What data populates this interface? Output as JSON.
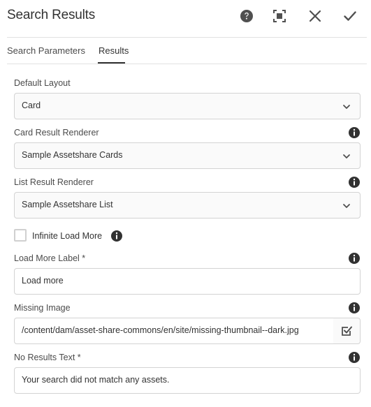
{
  "dialog": {
    "title": "Search Results"
  },
  "header_actions": {
    "help_icon": "question-circle-icon",
    "fullscreen_icon": "fullscreen-icon",
    "close_icon": "close-icon",
    "confirm_icon": "checkmark-icon"
  },
  "tabs": [
    {
      "label": "Search Parameters",
      "active": false
    },
    {
      "label": "Results",
      "active": true
    }
  ],
  "fields": {
    "default_layout": {
      "label": "Default Layout",
      "value": "Card"
    },
    "card_renderer": {
      "label": "Card Result Renderer",
      "value": "Sample Assetshare Cards"
    },
    "list_renderer": {
      "label": "List Result Renderer",
      "value": "Sample Assetshare List"
    },
    "infinite_load": {
      "label": "Infinite Load More",
      "checked": false
    },
    "load_more_label": {
      "label": "Load More Label *",
      "value": "Load more"
    },
    "missing_image": {
      "label": "Missing Image",
      "value": "/content/dam/asset-share-commons/en/site/missing-thumbnail--dark.jpg"
    },
    "no_results_text": {
      "label": "No Results Text *",
      "value": "Your search did not match any assets."
    }
  },
  "colors": {
    "text": "#4b4b4b",
    "title": "#323232",
    "border": "#d3d3d3",
    "icon": "#505050"
  }
}
